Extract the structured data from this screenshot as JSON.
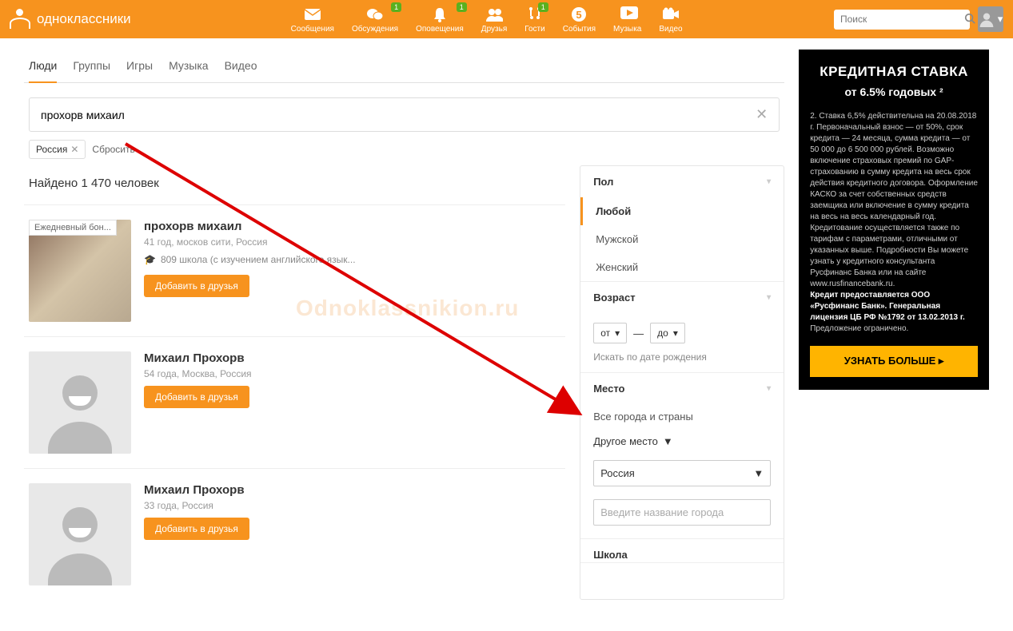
{
  "header": {
    "brand": "одноклассники",
    "nav": [
      {
        "label": "Сообщения",
        "icon": "mail"
      },
      {
        "label": "Обсуждения",
        "icon": "chat",
        "badge": "1"
      },
      {
        "label": "Оповещения",
        "icon": "bell",
        "badge": "1"
      },
      {
        "label": "Друзья",
        "icon": "friends"
      },
      {
        "label": "Гости",
        "icon": "guests",
        "badge": "1"
      },
      {
        "label": "События",
        "icon": "events"
      },
      {
        "label": "Музыка",
        "icon": "music"
      },
      {
        "label": "Видео",
        "icon": "video"
      }
    ],
    "search_placeholder": "Поиск"
  },
  "tabs": [
    "Люди",
    "Группы",
    "Игры",
    "Музыка",
    "Видео"
  ],
  "active_tab": "Люди",
  "search": {
    "query": "прохорв михаил",
    "chips": [
      "Россия"
    ],
    "reset": "Сбросить"
  },
  "found_text": "Найдено 1 470 человек",
  "bonus_tag": "Ежедневный бон...",
  "results": [
    {
      "name": "прохорв михаил",
      "sub": "41 год, москов сити, Россия",
      "school": "809 школа (с изучением английского язык...",
      "btn": "Добавить в друзья",
      "photo": true
    },
    {
      "name": "Михаил Прохорв",
      "sub": "54 года, Москва, Россия",
      "btn": "Добавить в друзья",
      "photo": false
    },
    {
      "name": "Михаил Прохорв",
      "sub": "33 года, Россия",
      "btn": "Добавить в друзья",
      "photo": false
    }
  ],
  "filters": {
    "gender": {
      "title": "Пол",
      "options": [
        "Любой",
        "Мужской",
        "Женский"
      ],
      "selected": "Любой"
    },
    "age": {
      "title": "Возраст",
      "from_lbl": "от",
      "to_lbl": "до",
      "dash": "—",
      "birth": "Искать по дате рождения"
    },
    "place": {
      "title": "Место",
      "all": "Все города и страны",
      "other": "Другое место",
      "country": "Россия",
      "city_placeholder": "Введите название города"
    },
    "school_title": "Школа"
  },
  "ad": {
    "title": "КРЕДИТНАЯ СТАВКА",
    "sub": "от 6.5% годовых ²",
    "body_pre": "2. Ставка 6,5% действительна на 20.08.2018 г. Первоначальный взнос — от 50%, срок кредита — 24 месяца, сумма кредита — от 50 000 до 6 500 000 рублей. Возможно включение страховых премий по GAP-страхованию в сумму кредита на весь срок действия кредитного договора. Оформление КАСКО за счет собственных средств заемщика или включение в сумму кредита на весь на весь календарный год. Кредитование осуществляется также по тарифам с параметрами, отличными от указанных выше. Подробности Вы можете узнать у кредитного консультанта Русфинанс Банка или на сайте www.rusfinancebank.ru.",
    "body_strong": "Кредит предоставляется ООО «Русфинанс Банк». Генеральная лицензия ЦБ РФ №1792 от 13.02.2013 г.",
    "body_post": " Предложение ограничено.",
    "btn": "УЗНАТЬ БОЛЬШЕ ▸"
  },
  "watermark": "Odnoklassnikion.ru"
}
